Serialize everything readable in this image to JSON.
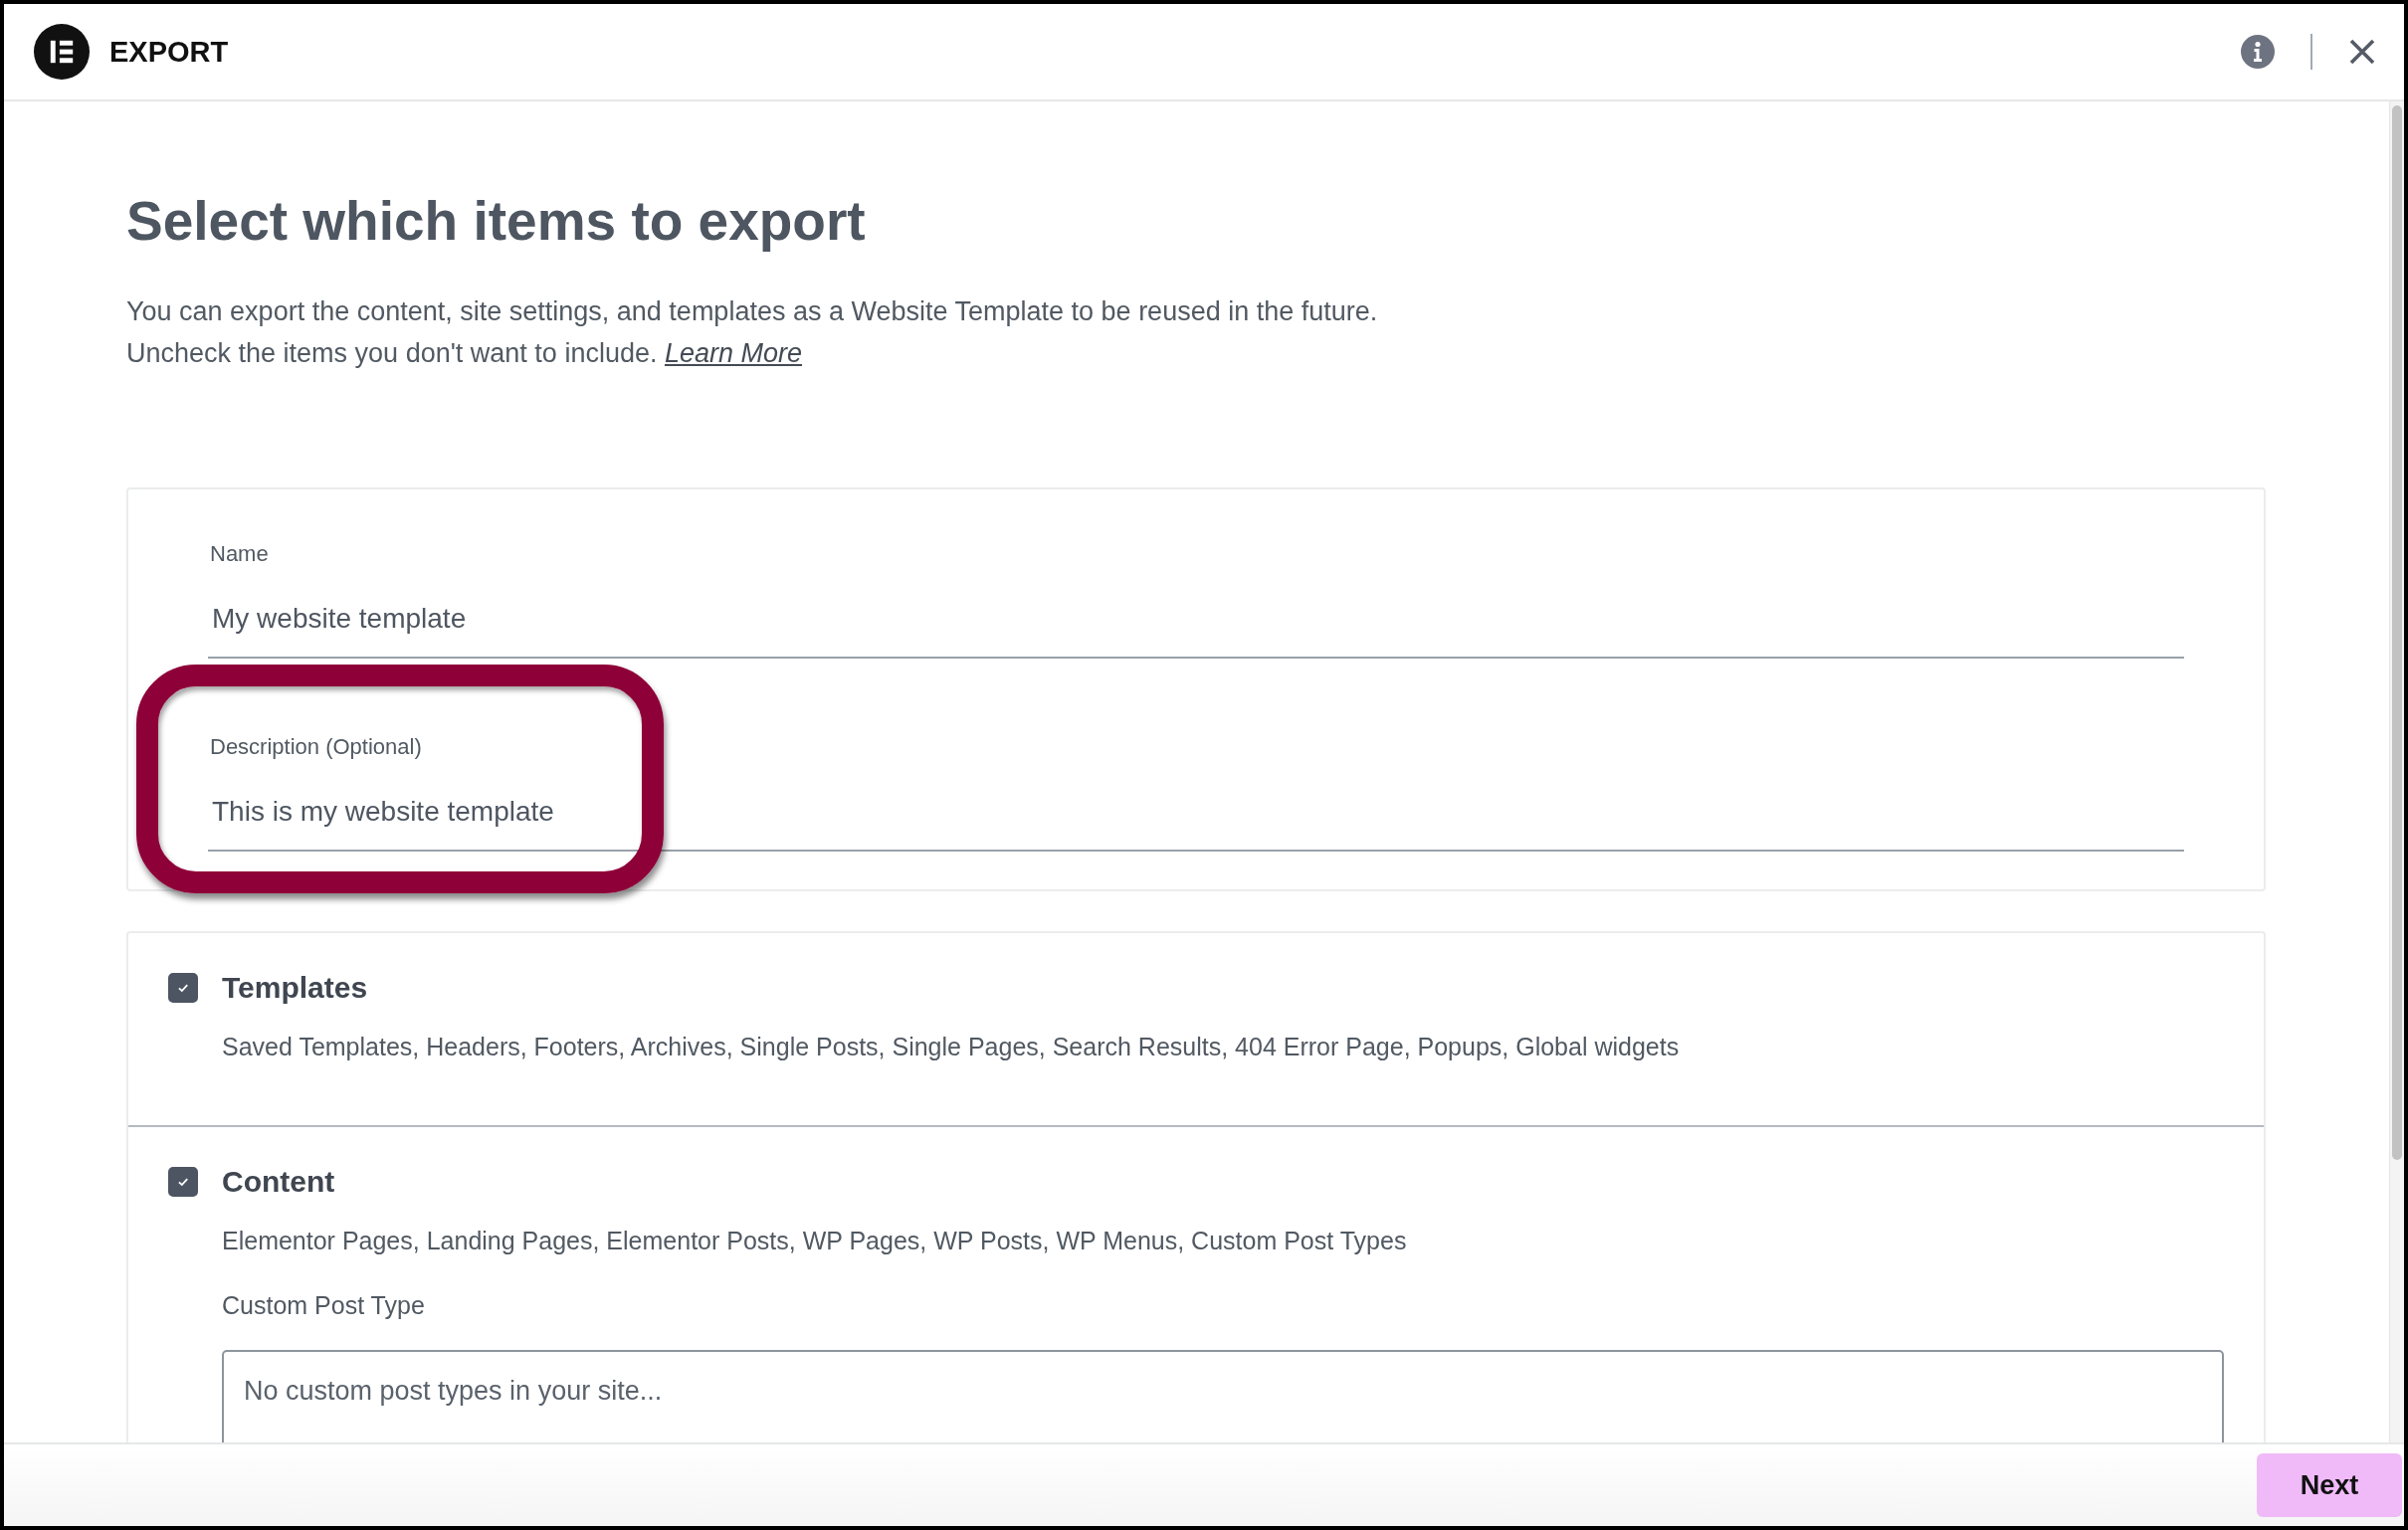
{
  "header": {
    "title": "EXPORT"
  },
  "intro": {
    "heading": "Select which items to export",
    "line_1": "You can export the content, site settings, and templates as a Website Template to be reused in the future.",
    "line_2": "Uncheck the items you don't want to include.",
    "link": "Learn More"
  },
  "fields": [
    {
      "label": "Name",
      "value": "My website template",
      "highlighted": false
    },
    {
      "label": "Description (Optional)",
      "value": "This is my website template",
      "highlighted": true
    }
  ],
  "sections": [
    {
      "title": "Templates",
      "checked": true,
      "description": "Saved Templates, Headers, Footers, Archives, Single Posts, Single Pages, Search Results, 404 Error Page, Popups, Global widgets"
    },
    {
      "title": "Content",
      "checked": true,
      "description": "Elementor Pages, Landing Pages, Elementor Posts, WP Pages, WP Posts, WP Menus, Custom Post Types",
      "select_label": "Custom Post Type",
      "select_placeholder": "No custom post types in your site..."
    }
  ],
  "footer": {
    "next_button": "Next"
  }
}
